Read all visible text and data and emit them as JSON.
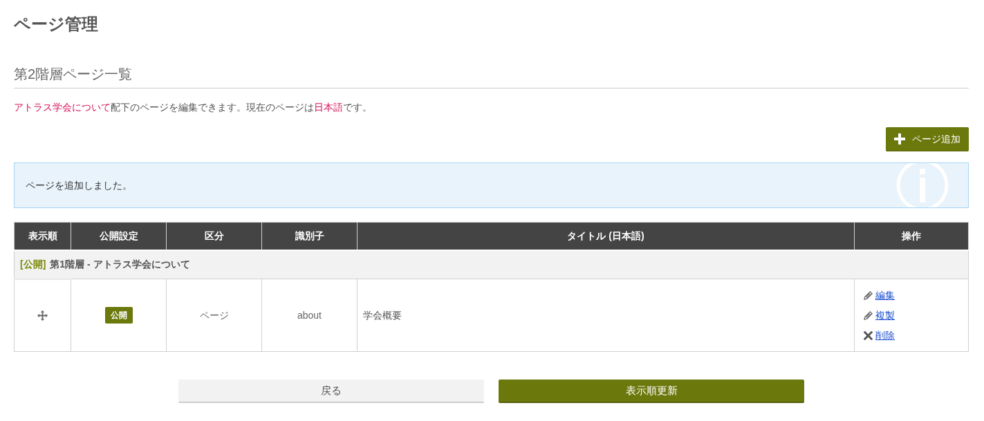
{
  "page_title": "ページ管理",
  "section_title": "第2階層ページ一覧",
  "description": [
    {
      "kind": "highlight",
      "text": "アトラス学会について"
    },
    {
      "kind": "plain",
      "text": "配下のページを編集できます。現在のページは"
    },
    {
      "kind": "highlight",
      "text": "日本語"
    },
    {
      "kind": "plain",
      "text": "です。"
    }
  ],
  "add_button": {
    "label": "ページ追加"
  },
  "alert": {
    "message": "ページを追加しました。"
  },
  "table": {
    "columns": [
      "表示順",
      "公開設定",
      "区分",
      "識別子",
      "タイトル (日本語)",
      "操作"
    ],
    "groups": [
      {
        "status": "[公開]",
        "title": "第1階層 - アトラス学会について",
        "rows": [
          {
            "status_badge": "公開",
            "type": "ページ",
            "identifier": "about",
            "title": "学会概要",
            "actions": [
              {
                "kind": "edit",
                "label": "編集"
              },
              {
                "kind": "copy",
                "label": "複製"
              },
              {
                "kind": "delete",
                "label": "削除"
              }
            ]
          }
        ]
      }
    ]
  },
  "footer_buttons": [
    {
      "kind": "secondary",
      "label": "戻る"
    },
    {
      "kind": "primary",
      "label": "表示順更新"
    }
  ]
}
